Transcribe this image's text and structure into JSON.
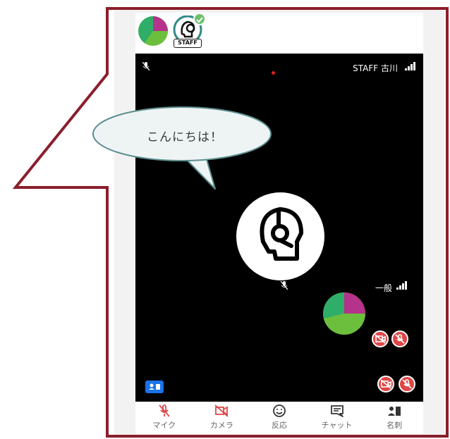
{
  "bubble": {
    "text": "こんにちは！"
  },
  "topbar": {
    "staff_tag": "STAFF"
  },
  "video": {
    "main_participant_label": "STAFF 古川",
    "second_participant_label": "一般"
  },
  "toolbar": {
    "items": [
      {
        "label": "マイク",
        "icon": "mic-off-icon"
      },
      {
        "label": "カメラ",
        "icon": "camera-off-icon"
      },
      {
        "label": "反応",
        "icon": "smiley-icon"
      },
      {
        "label": "チャット",
        "icon": "chat-icon"
      },
      {
        "label": "名刺",
        "icon": "business-card-icon"
      }
    ]
  },
  "colors": {
    "callout_border": "#8b1e2b",
    "bubble_fill": "#eef4f4",
    "bubble_border": "#5d8d8f",
    "toolbar_red": "#e04647",
    "card_blue": "#1a73e8",
    "pie_green": "#6cbf3c",
    "pie_teal": "#2fae6a",
    "pie_magenta": "#b5338a"
  }
}
